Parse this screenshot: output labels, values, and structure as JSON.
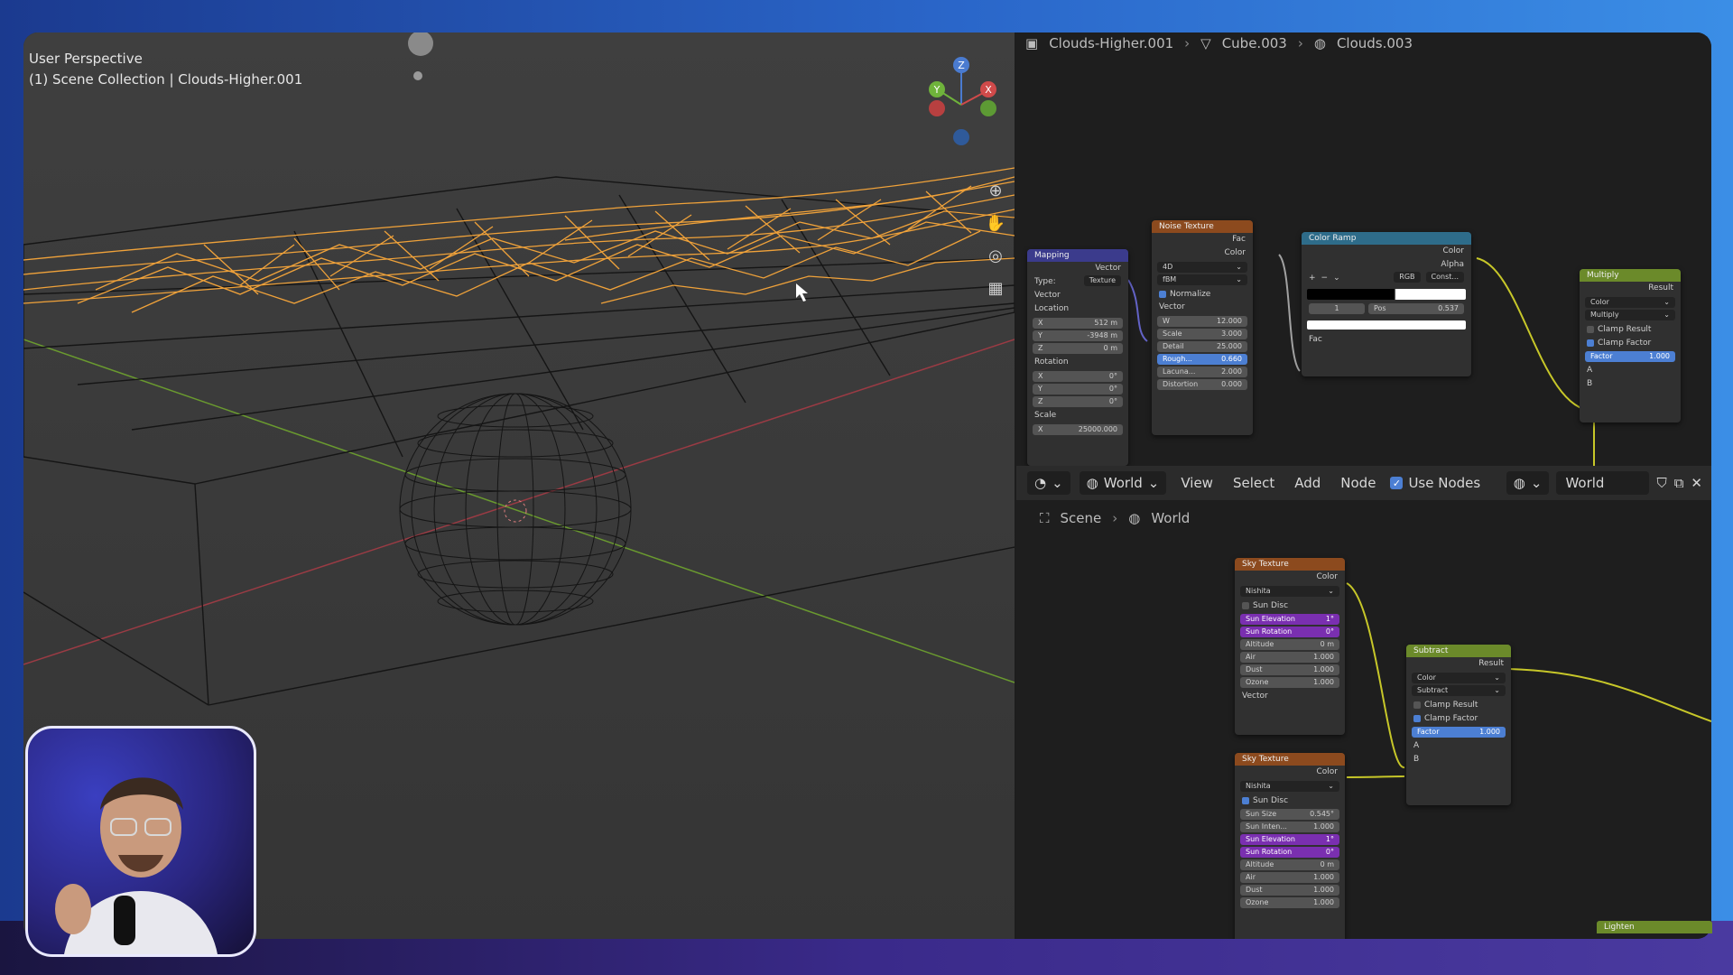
{
  "viewport": {
    "perspective": "User Perspective",
    "collection": "(1) Scene Collection | Clouds-Higher.001",
    "gizmo": {
      "z": "Z",
      "y": "Y",
      "x": "X"
    },
    "nav_icons": [
      "zoom-icon",
      "hand-pan-icon",
      "camera-icon",
      "grid-icon"
    ]
  },
  "top_editor": {
    "breadcrumb": [
      "Clouds-Higher.001",
      "Cube.003",
      "Clouds.003"
    ],
    "nodes": {
      "mapping": {
        "title": "Mapping",
        "out_vector": "Vector",
        "type_label": "Type:",
        "type_value": "Texture",
        "vector": "Vector",
        "location": "Location",
        "loc_x_label": "X",
        "loc_x": "512 m",
        "loc_y_label": "Y",
        "loc_y": "-3948 m",
        "loc_z_label": "Z",
        "loc_z": "0 m",
        "rotation": "Rotation",
        "rot_x_label": "X",
        "rot_x": "0°",
        "rot_y_label": "Y",
        "rot_y": "0°",
        "rot_z_label": "Z",
        "rot_z": "0°",
        "scale": "Scale",
        "scale_x_label": "X",
        "scale_x": "25000.000"
      },
      "noise": {
        "title": "Noise Texture",
        "fac": "Fac",
        "color": "Color",
        "dim": "4D",
        "basis": "fBM",
        "normalize": "Normalize",
        "vector": "Vector",
        "w_label": "W",
        "w": "12.000",
        "scale_label": "Scale",
        "scale": "3.000",
        "detail_label": "Detail",
        "detail": "25.000",
        "rough_label": "Rough...",
        "rough": "0.660",
        "lacuna_label": "Lacuna...",
        "lacuna": "2.000",
        "distortion_label": "Distortion",
        "distortion": "0.000"
      },
      "ramp": {
        "title": "Color Ramp",
        "color": "Color",
        "alpha": "Alpha",
        "plus": "+",
        "minus": "−",
        "chev": "⌄",
        "mode": "RGB",
        "interp": "Const...",
        "index": "1",
        "pos_label": "Pos",
        "pos": "0.537",
        "fac": "Fac"
      },
      "multiply": {
        "title": "Multiply",
        "result": "Result",
        "type": "Color",
        "op": "Multiply",
        "clamp_result": "Clamp Result",
        "clamp_factor": "Clamp Factor",
        "factor_label": "Factor",
        "factor": "1.000",
        "a": "A",
        "b": "B"
      }
    }
  },
  "header": {
    "editor_type_icon": "world-icon",
    "shader_type": "World",
    "menus": [
      "View",
      "Select",
      "Add",
      "Node"
    ],
    "use_nodes_label": "Use Nodes",
    "world_name": "World"
  },
  "bottom_editor": {
    "breadcrumb": [
      "Scene",
      "World"
    ],
    "sky1": {
      "title": "Sky Texture",
      "color": "Color",
      "model": "Nishita",
      "sun_disc": "Sun Disc",
      "sun_elev_label": "Sun Elevation",
      "sun_elev": "1°",
      "sun_rot_label": "Sun Rotation",
      "sun_rot": "0°",
      "alt_label": "Altitude",
      "alt": "0 m",
      "air_label": "Air",
      "air": "1.000",
      "dust_label": "Dust",
      "dust": "1.000",
      "ozone_label": "Ozone",
      "ozone": "1.000",
      "vector": "Vector"
    },
    "sky2": {
      "title": "Sky Texture",
      "color": "Color",
      "model": "Nishita",
      "sun_disc": "Sun Disc",
      "sun_size_label": "Sun Size",
      "sun_size": "0.545°",
      "sun_int_label": "Sun Inten...",
      "sun_int": "1.000",
      "sun_elev_label": "Sun Elevation",
      "sun_elev": "1°",
      "sun_rot_label": "Sun Rotation",
      "sun_rot": "0°",
      "alt_label": "Altitude",
      "alt": "0 m",
      "air_label": "Air",
      "air": "1.000",
      "dust_label": "Dust",
      "dust": "1.000",
      "ozone_label": "Ozone",
      "ozone": "1.000"
    },
    "subtract": {
      "title": "Subtract",
      "result": "Result",
      "type": "Color",
      "op": "Subtract",
      "clamp_result": "Clamp Result",
      "clamp_factor": "Clamp Factor",
      "factor_label": "Factor",
      "factor": "1.000",
      "a": "A",
      "b": "B"
    },
    "lighten": "Lighten"
  },
  "colors": {
    "wire_selected": "#f0a23a",
    "wire": "#121212",
    "accent": "#4c7fd3"
  }
}
